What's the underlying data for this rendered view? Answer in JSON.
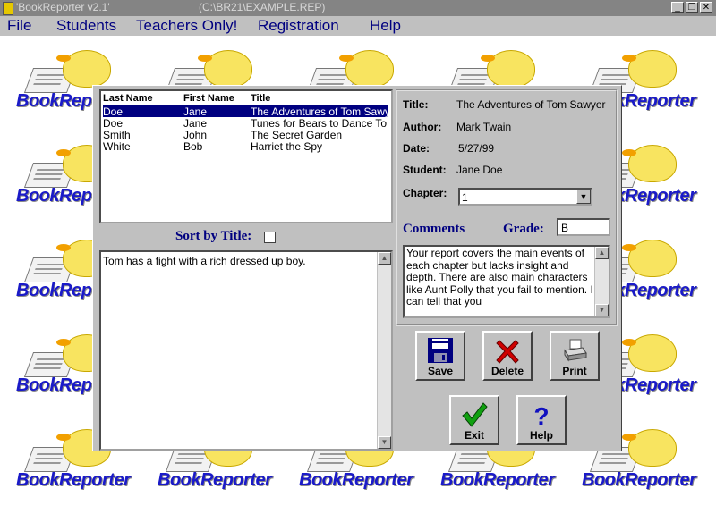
{
  "window": {
    "title": "'BookReporter v2.1'",
    "filepath": "(C:\\BR21\\EXAMPLE.REP)",
    "minimize": "_",
    "restore": "❐",
    "close": "✕"
  },
  "menu": [
    "File",
    "Students",
    "Teachers Only!",
    "Registration",
    "Help"
  ],
  "wallpaper": {
    "logo_text": "BookReporter"
  },
  "list": {
    "headers": [
      "Last Name",
      "First Name",
      "Title"
    ],
    "rows": [
      [
        "Doe",
        "Jane",
        "The Adventures of Tom Sawyer"
      ],
      [
        "Doe",
        "Jane",
        "Tunes for Bears to Dance To"
      ],
      [
        "Smith",
        "John",
        "The Secret Garden"
      ],
      [
        "White",
        "Bob",
        "Harriet the Spy"
      ]
    ],
    "selected_index": 0
  },
  "sort": {
    "label": "Sort by Title:",
    "checked": false
  },
  "notes": {
    "text": "Tom has a fight with a rich dressed up boy."
  },
  "details": {
    "title_label": "Title:",
    "title_value": "The Adventures of Tom Sawyer",
    "author_label": "Author:",
    "author_value": "Mark Twain",
    "date_label": "Date:",
    "date_value": "5/27/99",
    "student_label": "Student:",
    "student_value": "Jane Doe",
    "chapter_label": "Chapter:",
    "chapter_value": "1",
    "comments_label": "Comments",
    "grade_label": "Grade:",
    "grade_value": "B",
    "comments_text": "Your report covers the main events of each chapter but lacks insight and depth.  There are also main characters like Aunt Polly that you fail to mention.  I can tell that you"
  },
  "buttons": {
    "save": "Save",
    "delete": "Delete",
    "print": "Print",
    "exit": "Exit",
    "help": "Help"
  },
  "icons": {
    "save": "floppy-disk-icon",
    "delete": "red-x-icon",
    "print": "printer-icon",
    "exit": "green-check-icon",
    "help": "question-mark-icon"
  }
}
